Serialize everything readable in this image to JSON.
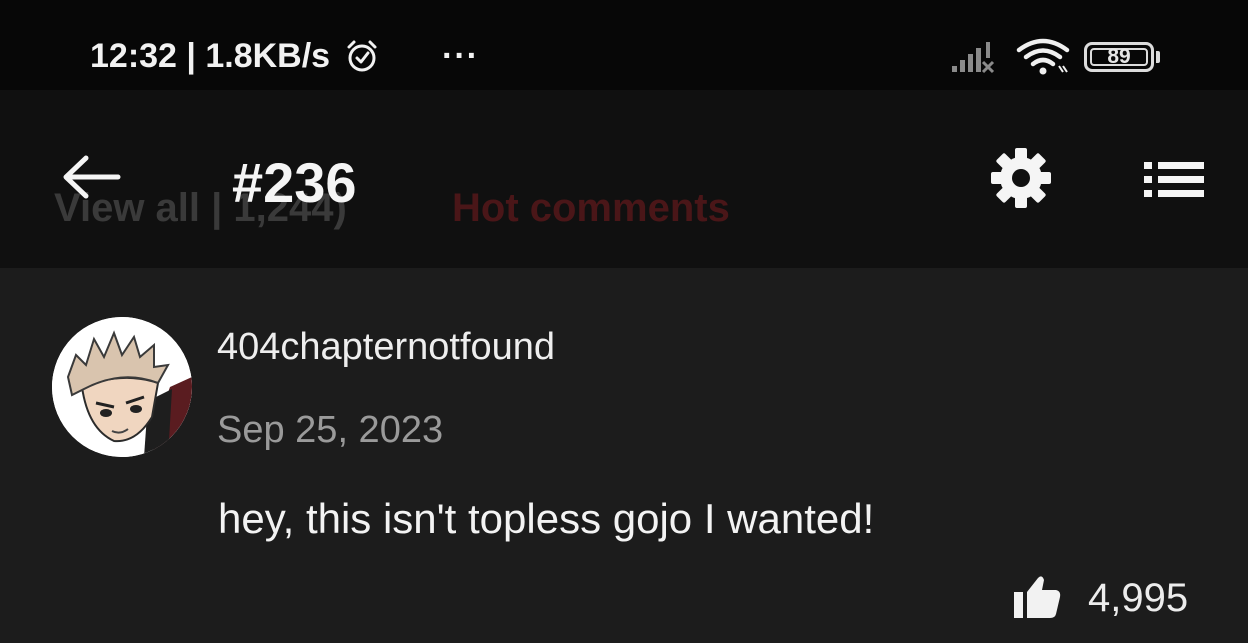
{
  "status_bar": {
    "time_speed": "12:32 | 1.8KB/s",
    "more": "···",
    "battery": "89",
    "icons": [
      "alarm-icon",
      "signal-icon",
      "wifi-icon",
      "battery-icon"
    ]
  },
  "app_bar": {
    "title": "#236",
    "view_all_tab": "View all | 1,244)",
    "hot_comments_tab": "Hot comments",
    "icons": [
      "back-arrow-icon",
      "gear-icon",
      "list-icon"
    ]
  },
  "comment": {
    "username": "404chapternotfound",
    "date": "Sep 25, 2023",
    "text": "hey, this isn't topless gojo I wanted!",
    "likes": "4,995"
  },
  "colors": {
    "status_bg": "#070707",
    "appbar_bg": "#101010",
    "content_bg": "#1c1c1c",
    "hot_tab": "#4a1618"
  }
}
